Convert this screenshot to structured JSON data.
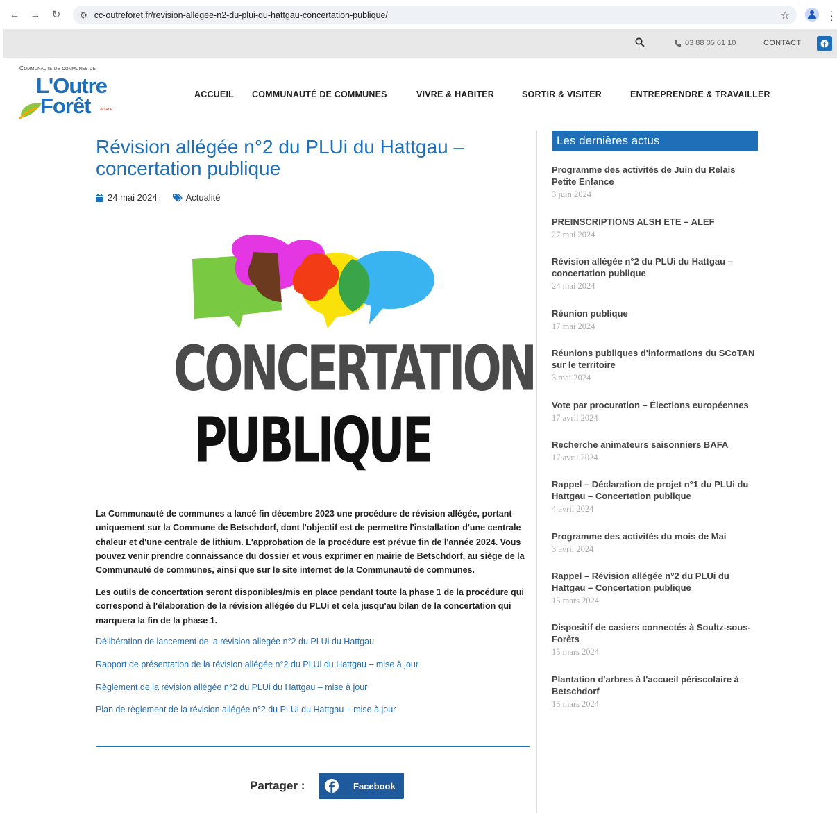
{
  "browser": {
    "url": "cc-outreforet.fr/revision-allegee-n2-du-plui-du-hattgau-concertation-publique/"
  },
  "utility": {
    "phone": "03 88 05 61 10",
    "contact": "CONTACT"
  },
  "logo": {
    "subtitle": "Communauté de communes de",
    "line1": "L'Outre",
    "line2": "Forêt",
    "region": "Alsace"
  },
  "nav": {
    "items": [
      {
        "label": "ACCUEIL"
      },
      {
        "label": "COMMUNAUTÉ DE COMMUNES"
      },
      {
        "label": "VIVRE & HABITER"
      },
      {
        "label": "SORTIR & VISITER"
      },
      {
        "label": "ENTREPRENDRE & TRAVAILLER"
      }
    ]
  },
  "article": {
    "title": "Révision allégée n°2 du PLUi du Hattgau – concertation publique",
    "date": "24 mai 2024",
    "category": "Actualité",
    "hero_line1": "CONCERTATION",
    "hero_line2": "PUBLIQUE",
    "paragraph1": "La Communauté de communes a lancé fin décembre 2023 une procédure de révision allégée, portant uniquement sur la Commune de Betschdorf, dont l'objectif est de permettre l'installation d'une centrale chaleur et d'une centrale de lithium. L'approbation de la procédure est prévue fin de l'année 2024. Vous pouvez venir prendre connaissance du dossier et vous exprimer en mairie de Betschdorf, au siège de la Communauté de communes, ainsi que sur le site internet de la Communauté de communes.",
    "paragraph2": "Les outils de concertation seront disponibles/mis en place pendant toute la phase 1 de la procédure qui correspond à l'élaboration de la révision allégée du PLUi et cela jusqu'au bilan de la concertation qui marquera la fin de la phase 1.",
    "links": [
      {
        "label": "Délibération de lancement de la révision allégée n°2 du PLUi du Hattgau"
      },
      {
        "label": "Rapport de présentation de la révision allégée n°2 du PLUi du Hattgau – mise à jour"
      },
      {
        "label": "Règlement de la révision allégée n°2 du PLUi du Hattgau – mise à jour"
      },
      {
        "label": "Plan de règlement de la révision allégée n°2 du PLUi du Hattgau – mise à jour"
      }
    ],
    "share_label": "Partager :",
    "share_facebook": "Facebook"
  },
  "sidebar": {
    "title": "Les dernières actus",
    "items": [
      {
        "title": "Programme des activités de Juin du Relais Petite Enfance",
        "date": "3 juin 2024"
      },
      {
        "title": "PREINSCRIPTIONS ALSH ETE – ALEF",
        "date": "27 mai 2024"
      },
      {
        "title": "Révision allégée n°2 du PLUi du Hattgau – concertation publique",
        "date": "24 mai 2024"
      },
      {
        "title": "Réunion publique",
        "date": "17 mai 2024"
      },
      {
        "title": "Réunions publiques d'informations du SCoTAN sur le territoire",
        "date": "3 mai 2024"
      },
      {
        "title": "Vote par procuration – Élections européennes",
        "date": "17 avril 2024"
      },
      {
        "title": "Recherche animateurs saisonniers BAFA",
        "date": "17 avril 2024"
      },
      {
        "title": "Rappel – Déclaration de projet n°1 du PLUi du Hattgau – Concertation publique",
        "date": "4 avril 2024"
      },
      {
        "title": "Programme des activités du mois de Mai",
        "date": "3 avril 2024"
      },
      {
        "title": "Rappel – Révision allégée n°2 du PLUi du Hattgau – Concertation publique",
        "date": "15 mars 2024"
      },
      {
        "title": "Dispositif de casiers connectés à Soultz-sous-Forêts",
        "date": "15 mars 2024"
      },
      {
        "title": "Plantation d'arbres à l'accueil périscolaire à Betschdorf",
        "date": "15 mars 2024"
      }
    ]
  },
  "colors": {
    "brand_blue": "#1e6eb8",
    "facebook_blue": "#1e5a9c"
  }
}
